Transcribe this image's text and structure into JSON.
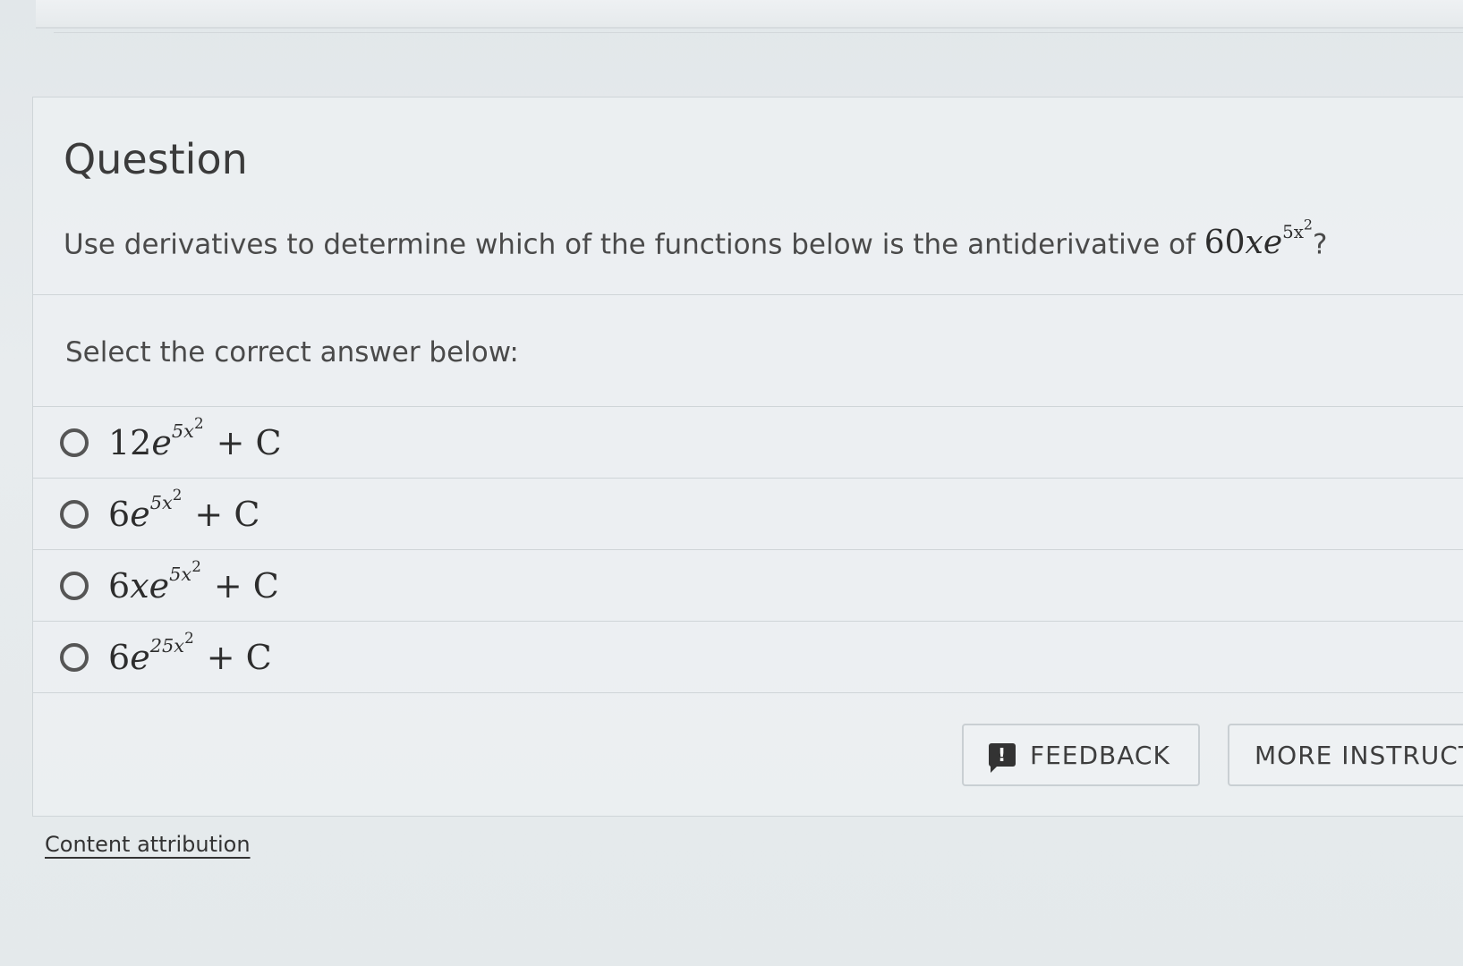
{
  "question": {
    "title": "Question",
    "prompt": "Use derivatives to determine which of the functions below is the antiderivative of",
    "prompt_end": "?",
    "expr": {
      "coef": "60",
      "vars": "xe",
      "exp_coef": "5x",
      "exp_pow": "2"
    }
  },
  "select_label": "Select the correct answer below:",
  "options": [
    {
      "coef": "12",
      "vars": "e",
      "exp_coef": "5x",
      "exp_pow": "2",
      "tail": "+ C"
    },
    {
      "coef": "6",
      "vars": "e",
      "exp_coef": "5x",
      "exp_pow": "2",
      "tail": "+ C"
    },
    {
      "coef": "6",
      "vars": "xe",
      "exp_coef": "5x",
      "exp_pow": "2",
      "tail": "+ C"
    },
    {
      "coef": "6",
      "vars": "e",
      "exp_coef": "25x",
      "exp_pow": "2",
      "tail": "+ C"
    }
  ],
  "buttons": {
    "feedback_icon": "!",
    "feedback": "FEEDBACK",
    "more": "MORE INSTRUCTIONS"
  },
  "attribution": "Content attribution",
  "icons": {
    "feedback": "feedback-icon"
  }
}
